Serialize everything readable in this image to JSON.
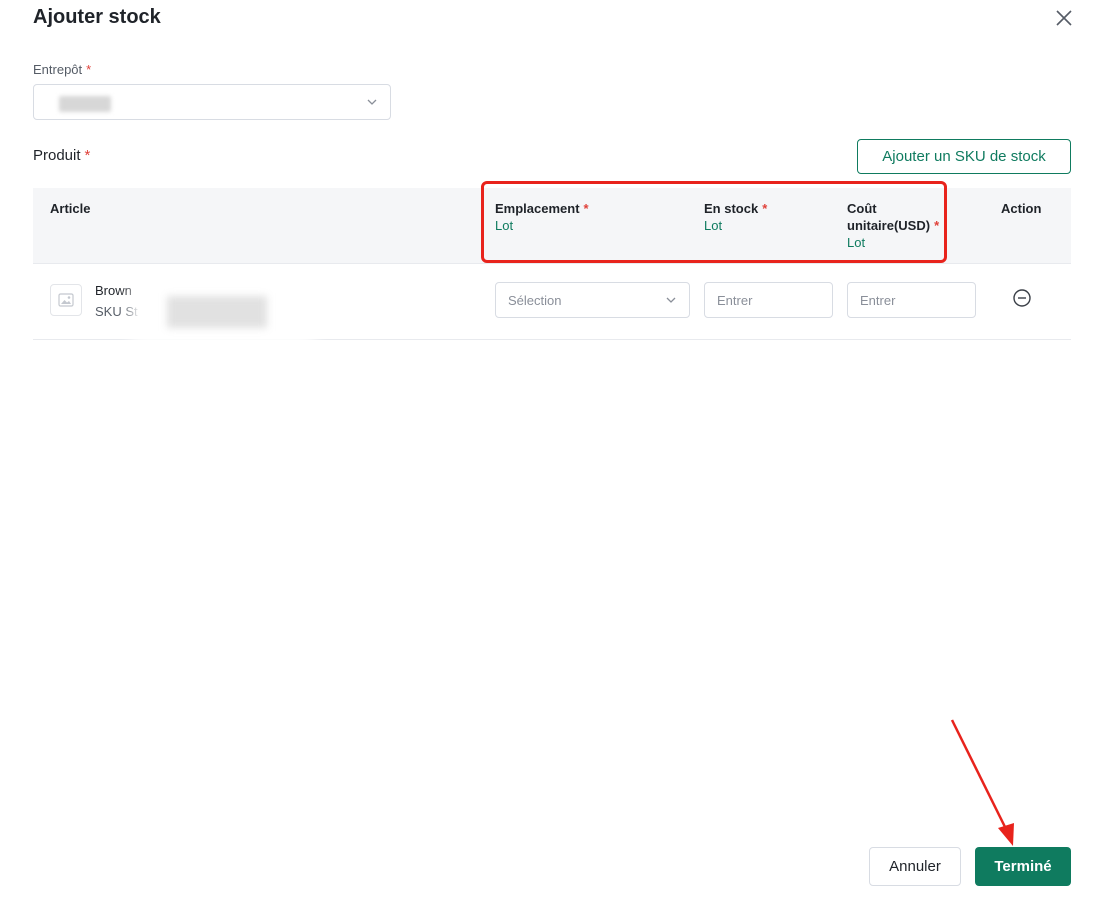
{
  "dialog": {
    "title": "Ajouter stock"
  },
  "warehouse": {
    "label": "Entrepôt",
    "required_mark": "*"
  },
  "product": {
    "label": "Produit",
    "required_mark": "*",
    "add_sku_button": "Ajouter un SKU de stock"
  },
  "table": {
    "headers": {
      "article": "Article",
      "location": "Emplacement",
      "location_sub": "Lot",
      "in_stock": "En stock",
      "in_stock_sub": "Lot",
      "unit_cost": "Coût unitaire(USD)",
      "unit_cost_sub": "Lot",
      "action": "Action",
      "required_mark": "*"
    },
    "rows": [
      {
        "name": "Brown",
        "sku": "SKU St",
        "location_placeholder": "Sélection",
        "stock_placeholder": "Entrer",
        "cost_placeholder": "Entrer"
      }
    ]
  },
  "footer": {
    "cancel_label": "Annuler",
    "done_label": "Terminé"
  },
  "colors": {
    "accent": "#0f7b5f",
    "required": "#e0413a",
    "annotation": "#e8231c"
  },
  "icons": {
    "close": "close-icon",
    "chevron": "chevron-down-icon",
    "thumbnail": "image-placeholder-icon",
    "remove": "minus-circle-icon"
  }
}
